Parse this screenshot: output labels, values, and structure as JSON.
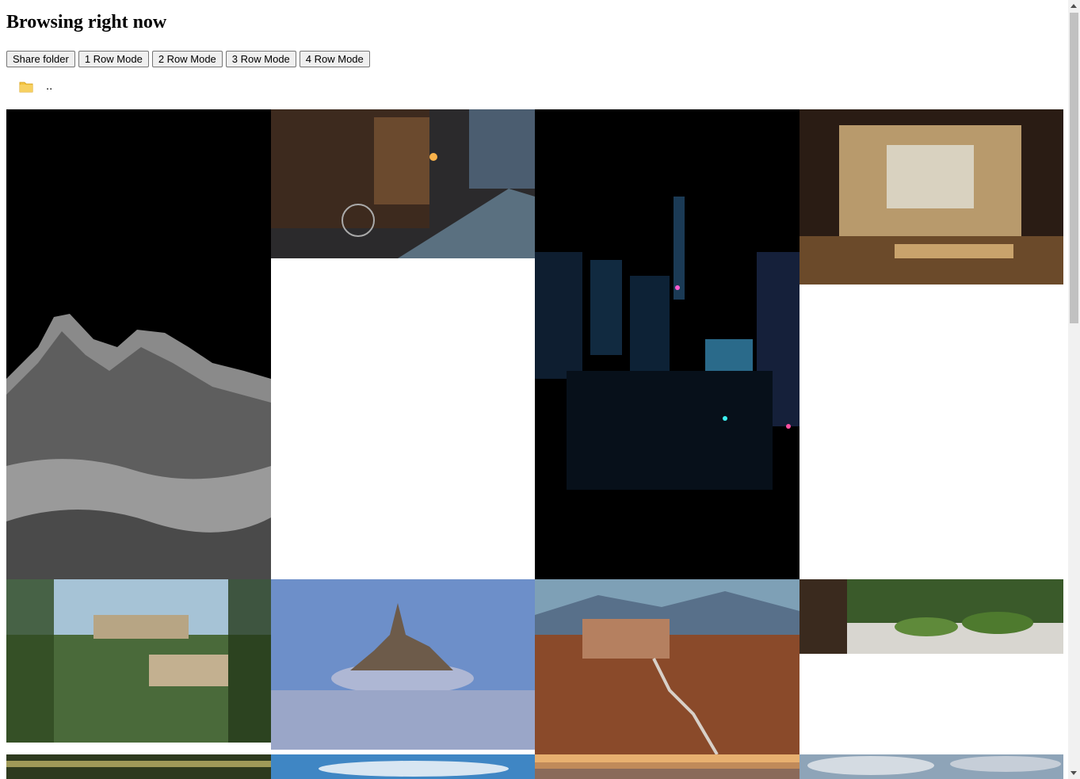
{
  "page": {
    "title": "Browsing right now"
  },
  "toolbar": {
    "share_label": "Share folder",
    "mode1_label": "1 Row Mode",
    "mode2_label": "2 Row Mode",
    "mode3_label": "3 Row Mode",
    "mode4_label": "4 Row Mode"
  },
  "folder": {
    "icon": "folder-icon",
    "parent_label": ".."
  },
  "gallery": {
    "images": [
      "mountain-clouds-bw",
      "kyoto-street-night",
      "city-neon-night",
      "japanese-room-shoji",
      "hilltop-castle-aqueduct",
      "mont-saint-michel-fog",
      "civita-di-bagnoregio",
      "japanese-zen-garden",
      "sunset-landscape",
      "blue-sky-clouds",
      "orange-sunset-sky",
      "cloudy-sky"
    ]
  },
  "colors": {
    "accent_folder": "#f5c542"
  }
}
